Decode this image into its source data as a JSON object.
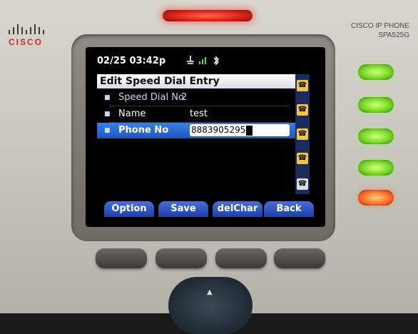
{
  "brand": {
    "logo": "CISCO",
    "model_line1": "CISCO IP PHONE",
    "model_line2": "SPA525G"
  },
  "status_bar": {
    "datetime": "02/25 03:42p",
    "icons": [
      "network-icon",
      "signal-icon",
      "bluetooth-icon"
    ]
  },
  "screen": {
    "title": "Edit Speed Dial Entry",
    "fields": [
      {
        "label": "Speed Dial No",
        "value": "2"
      },
      {
        "label": "Name",
        "value": "test"
      },
      {
        "label": "Phone No",
        "value": "8883905295"
      }
    ]
  },
  "softkeys": [
    "Option",
    "Save",
    "delChar",
    "Back"
  ],
  "line_keys": [
    "phone-icon",
    "phone-icon",
    "phone-icon",
    "phone-icon",
    "phone-icon"
  ],
  "leds": [
    "green",
    "green",
    "green",
    "green",
    "orange"
  ],
  "colors": {
    "selection": "#1b56c2",
    "softkey": "#2447b8",
    "led_green": "#78d82a",
    "led_red": "#ff6e2a"
  }
}
